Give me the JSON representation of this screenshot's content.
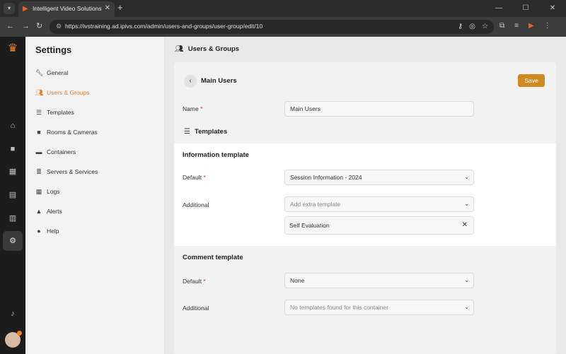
{
  "browser": {
    "tab_title": "Intelligent Video Solutions",
    "url": "https://ivstraining.ad.ipivs.com/admin/users-and-groups/user-group/edit/10"
  },
  "sidebar": {
    "title": "Settings",
    "items": [
      {
        "label": "General",
        "icon": "wrench-icon"
      },
      {
        "label": "Users & Groups",
        "icon": "users-icon"
      },
      {
        "label": "Templates",
        "icon": "list-icon"
      },
      {
        "label": "Rooms & Cameras",
        "icon": "video-icon"
      },
      {
        "label": "Containers",
        "icon": "archive-icon"
      },
      {
        "label": "Servers & Services",
        "icon": "server-icon"
      },
      {
        "label": "Logs",
        "icon": "calendar-icon"
      },
      {
        "label": "Alerts",
        "icon": "warning-icon"
      },
      {
        "label": "Help",
        "icon": "help-icon"
      }
    ]
  },
  "main": {
    "header": "Users & Groups",
    "card_title": "Main Users",
    "save_label": "Save",
    "name_label": "Name",
    "name_value": "Main Users",
    "templates_title": "Templates",
    "info": {
      "heading": "Information template",
      "default_label": "Default",
      "default_value": "Session Information - 2024",
      "additional_label": "Additional",
      "additional_placeholder": "Add extra template",
      "selected": "Self Evaluation"
    },
    "comment": {
      "heading": "Comment template",
      "default_label": "Default",
      "default_value": "None",
      "additional_label": "Additional",
      "additional_value": "No templates found for this container"
    }
  },
  "colors": {
    "accent": "#e8812a",
    "save_button": "#d18a1f",
    "required": "#d0392b"
  }
}
